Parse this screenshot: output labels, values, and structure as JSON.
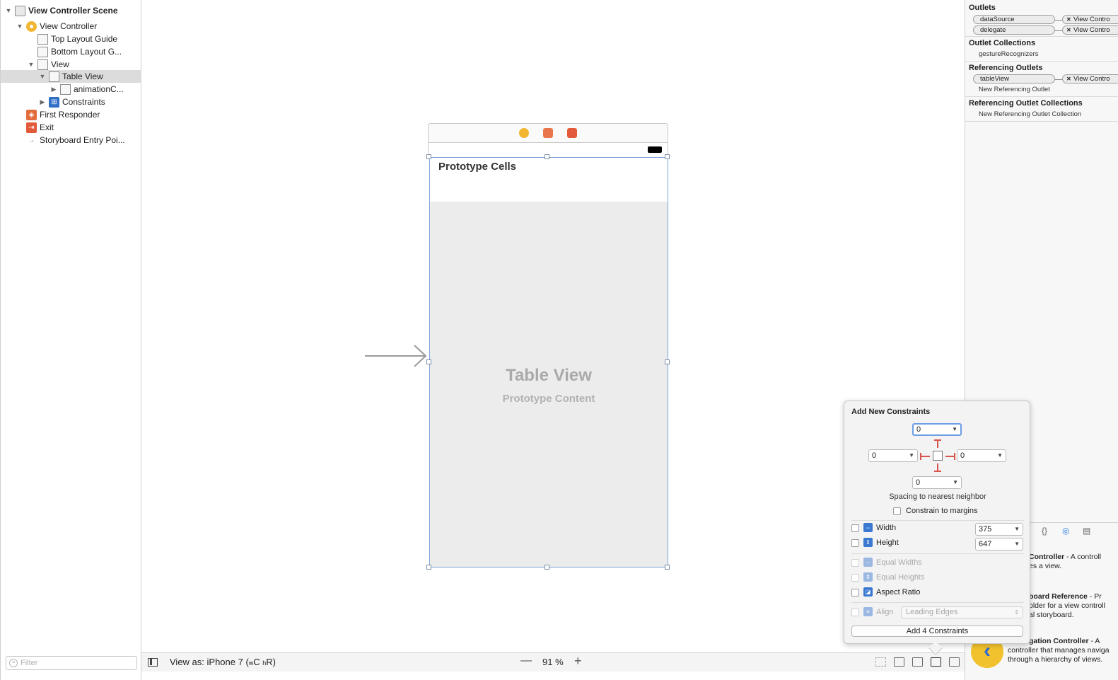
{
  "outline": {
    "rows": [
      {
        "label": "View Controller Scene"
      },
      {
        "label": "View Controller"
      },
      {
        "label": "Top Layout Guide"
      },
      {
        "label": "Bottom Layout G..."
      },
      {
        "label": "View"
      },
      {
        "label": "Table View"
      },
      {
        "label": "animationC..."
      },
      {
        "label": "Constraints"
      },
      {
        "label": "First Responder"
      },
      {
        "label": "Exit"
      },
      {
        "label": "Storyboard Entry Poi..."
      }
    ],
    "filter_placeholder": "Filter"
  },
  "canvas": {
    "prototype_cells_title": "Prototype Cells",
    "table_view_label": "Table View",
    "prototype_content_label": "Prototype Content"
  },
  "bottombar": {
    "view_as_prefix": "View as: iPhone 7 (",
    "view_as_w": "w",
    "view_as_c": "C ",
    "view_as_h": "h",
    "view_as_r": "R)",
    "zoom_out": "—",
    "zoom_level": "91 %",
    "zoom_in": "+"
  },
  "inspector": {
    "outlets_header": "Outlets",
    "outlets": [
      {
        "name": "dataSource",
        "target": "View Contro"
      },
      {
        "name": "delegate",
        "target": "View Contro"
      }
    ],
    "outlet_collections_header": "Outlet Collections",
    "outlet_collections_item": "gestureRecognizers",
    "referencing_outlets_header": "Referencing Outlets",
    "referencing_outlet": {
      "name": "tableView",
      "target": "View Contro"
    },
    "new_referencing_outlet": "New Referencing Outlet",
    "referencing_collections_header": "Referencing Outlet Collections",
    "new_referencing_collection": "New Referencing Outlet Collection",
    "library_tabs": [
      "{}",
      "◎",
      "▤"
    ],
    "library_entries": [
      {
        "title": "Controller",
        "desc1": " - A controll",
        "desc2": "es a view."
      },
      {
        "title": "board Reference",
        "desc1": " - Pr",
        "desc2": "older for a view controll",
        "desc3": "al storyboard."
      },
      {
        "title": "gation Controller",
        "desc1": " - A",
        "desc2": "controller that manages naviga",
        "desc3": "through a hierarchy of views."
      }
    ]
  },
  "popover": {
    "title": "Add New Constraints",
    "top_value": "0",
    "left_value": "0",
    "right_value": "0",
    "bottom_value": "0",
    "spacing_label": "Spacing to nearest neighbor",
    "constrain_margins_label": "Constrain to margins",
    "width_label": "Width",
    "width_value": "375",
    "height_label": "Height",
    "height_value": "647",
    "equal_widths_label": "Equal Widths",
    "equal_heights_label": "Equal Heights",
    "aspect_ratio_label": "Aspect Ratio",
    "align_label": "Align",
    "align_value": "Leading Edges",
    "add_button_label": "Add 4 Constraints"
  },
  "colors": {
    "selection_blue": "#7da3d6",
    "strut_red": "#d9534f",
    "constraint_icon_blue": "#3a78d1",
    "vc_yellow": "#f2b531"
  }
}
